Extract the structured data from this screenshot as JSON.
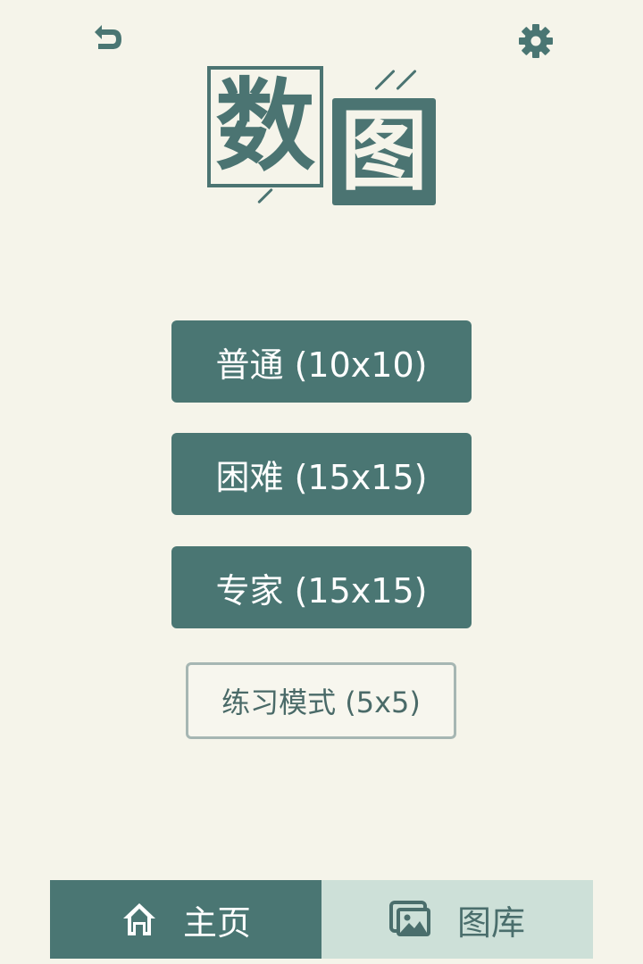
{
  "header": {
    "back_icon": "undo-arrow-icon",
    "settings_icon": "gear-icon"
  },
  "logo": {
    "char1": "数",
    "char2": "图"
  },
  "modes": {
    "normal": "普通 (10x10)",
    "hard": "困难 (15x15)",
    "expert": "专家 (15x15)",
    "practice": "练习模式 (5x5)"
  },
  "tabs": {
    "home": {
      "label": "主页",
      "icon": "home-icon",
      "active": true
    },
    "gallery": {
      "label": "图库",
      "icon": "image-gallery-icon",
      "active": false
    }
  },
  "colors": {
    "primary": "#4a7673",
    "background": "#f5f4ea",
    "tab_inactive": "#cde0d8",
    "outline": "#a6b6b3"
  }
}
